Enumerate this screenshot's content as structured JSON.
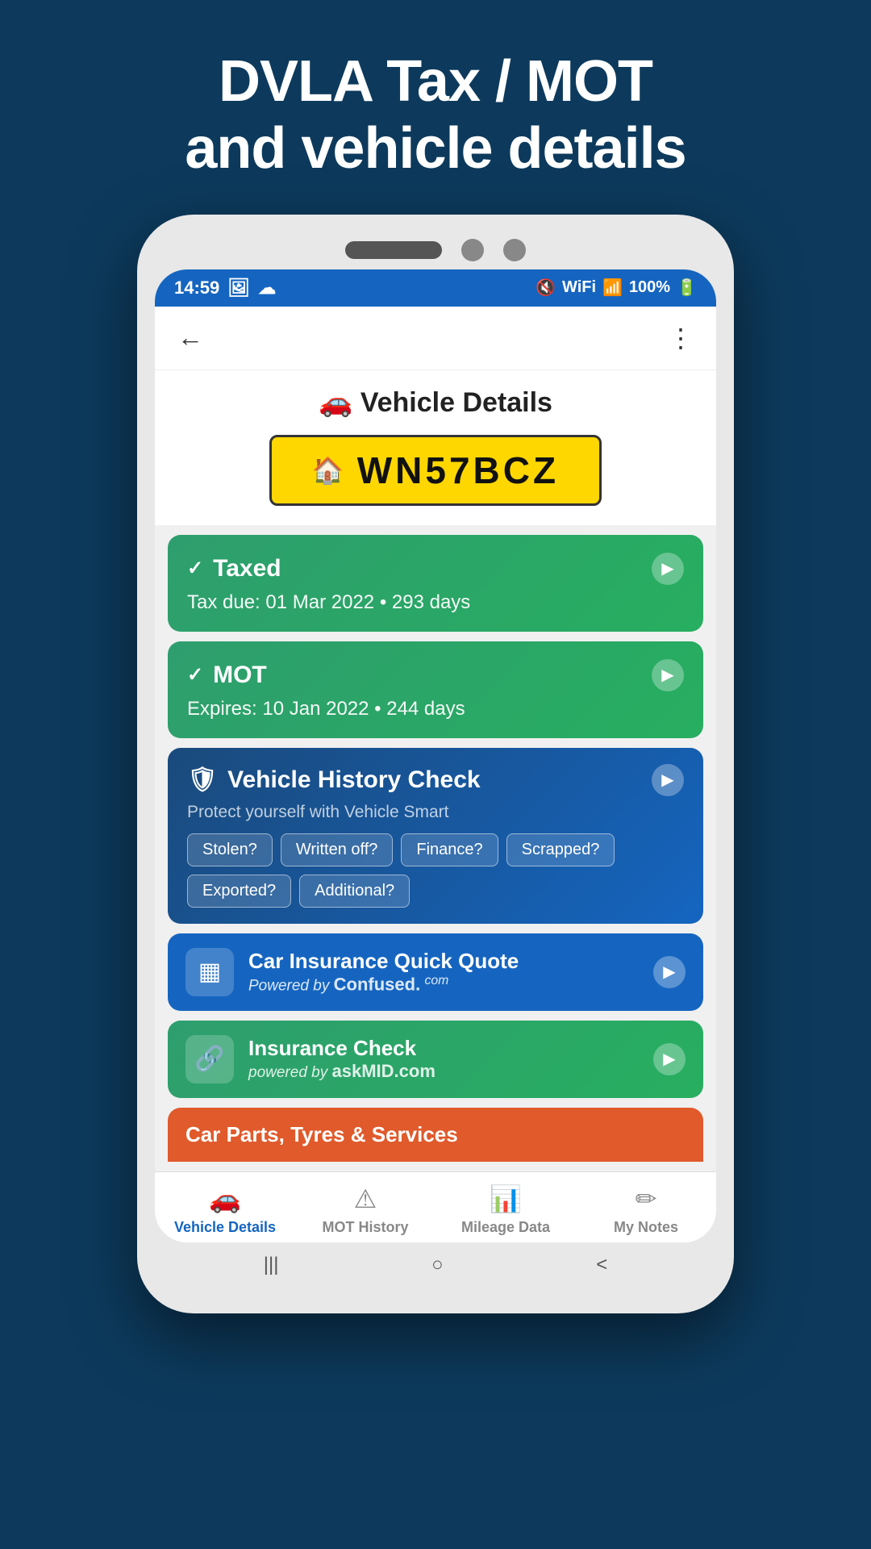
{
  "pageHeader": {
    "line1": "DVLA Tax / MOT",
    "line2": "and vehicle details"
  },
  "statusBar": {
    "time": "14:59",
    "battery": "100%"
  },
  "appHeader": {
    "backIcon": "←",
    "shareIcon": "⋮"
  },
  "pageTitle": {
    "icon": "🚗",
    "text": "Vehicle Details"
  },
  "licensePlate": {
    "icon": "🏠",
    "text": "WN57BCZ"
  },
  "taxCard": {
    "checkIcon": "✓",
    "title": "Taxed",
    "subtitle": "Tax due: 01 Mar 2022 • 293 days",
    "arrowIcon": "▶"
  },
  "motCard": {
    "checkIcon": "✓",
    "title": "MOT",
    "subtitle": "Expires: 10 Jan 2022 • 244 days",
    "arrowIcon": "▶"
  },
  "historyCard": {
    "shieldIcon": "🛡",
    "title": "Vehicle History Check",
    "subtitle": "Protect yourself with Vehicle Smart",
    "arrowIcon": "▶",
    "tags": [
      "Stolen?",
      "Written off?",
      "Finance?",
      "Scrapped?",
      "Exported?",
      "Additional?"
    ]
  },
  "insuranceQuoteCard": {
    "icon": "▦",
    "title": "Car Insurance Quick Quote",
    "subtitlePrefix": "Powered by",
    "subtitleBrand": "Confused.",
    "subtitleSuffix": "com",
    "arrowIcon": "▶"
  },
  "insuranceCheckCard": {
    "icon": "🔗",
    "title": "Insurance Check",
    "subtitlePrefix": "powered by",
    "subtitleBrand": "askMID.com",
    "arrowIcon": "▶"
  },
  "carPartsCard": {
    "titlePartial": "Car Parts, Tyres & Services"
  },
  "bottomNav": {
    "items": [
      {
        "icon": "🚗",
        "label": "Vehicle Details",
        "active": true
      },
      {
        "icon": "⚠",
        "label": "MOT History",
        "active": false
      },
      {
        "icon": "📊",
        "label": "Mileage Data",
        "active": false
      },
      {
        "icon": "✏",
        "label": "My Notes",
        "active": false
      }
    ]
  },
  "phoneGestures": {
    "gestures": [
      "|||",
      "○",
      "<"
    ]
  }
}
